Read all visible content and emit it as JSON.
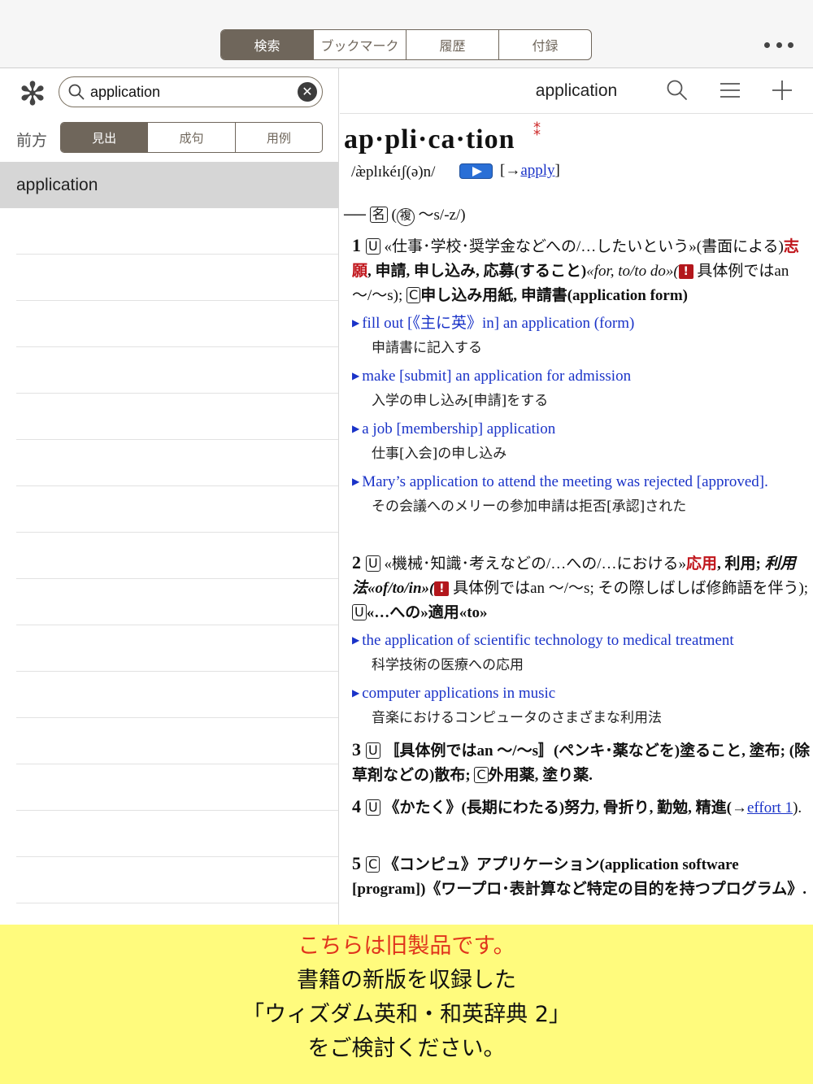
{
  "top_tabs": [
    "検索",
    "ブックマーク",
    "履歴",
    "付録"
  ],
  "top_tab_active": 0,
  "more_icon": "more-dots-icon",
  "search": {
    "value": "application",
    "clear_icon": "clear-icon",
    "search_icon": "search-icon",
    "wildcard_icon": "asterisk-icon"
  },
  "match_mode_label": "前方",
  "match_tabs": [
    "見出",
    "成句",
    "用例"
  ],
  "match_tab_active": 0,
  "results": [
    "application"
  ],
  "header": {
    "title": "application",
    "search_icon": "search-icon",
    "menu_icon": "menu-icon",
    "add_icon": "plus-icon"
  },
  "entry": {
    "headword": "ap·pli·ca·tion",
    "freq_mark": "⁑",
    "pronunciation": "/æ̀plɪkéɪʃ(ə)n/",
    "xref_prefix": "[→",
    "xref_link": "apply",
    "xref_suffix": "]",
    "pos_dash": "──",
    "pos": "名",
    "plural_mark": "複",
    "plural": "〜s/-z/)",
    "s1": {
      "num": "1",
      "label": "U",
      "t1": "«仕事･学校･奨学金などへの/…したいという»(書面による)",
      "red1": "志願",
      "t2": ", 申請, 申し込み, 応募(すること)",
      "t3": "«for, to/to do»(",
      "t4": "具体例ではan 〜/〜s);",
      "label2": "C",
      "t5": "申し込み用紙, 申請書(application form)"
    },
    "ex1": "fill out [《主に英》in] an application (form)",
    "ex1_tr": "申請書に記入する",
    "ex2": "make [submit] an application for admission",
    "ex2_tr": "入学の申し込み[申請]をする",
    "ex3": "a job [membership] application",
    "ex3_tr": "仕事[入会]の申し込み",
    "ex4": "Mary’s application to attend the meeting was rejected [approved].",
    "ex4_tr": "その会議へのメリーの参加申請は拒否[承認]された",
    "s2": {
      "num": "2",
      "label": "U",
      "t1": "«機械･知識･考えなどの/…への/…における»",
      "red1": "応用",
      "t2": ", 利用;",
      "t3": "利用法«of/to/in»(",
      "t4": "具体例ではan 〜/〜s; その際しばしば修飾語を伴う);",
      "label2": "U",
      "t5": "«…への»適用«to»"
    },
    "ex5": "the application of scientific technology to medical treatment",
    "ex5_tr": "科学技術の医療への応用",
    "ex6": "computer applications in music",
    "ex6_tr": "音楽におけるコンピュータのさまざまな利用法",
    "s3": {
      "num": "3",
      "label": "U",
      "t1": "〚具体例ではan 〜/〜s〛(ペンキ･薬などを)塗ること, 塗布; (除草剤などの)散布;",
      "label2": "C",
      "t2": "外用薬, 塗り薬."
    },
    "s4": {
      "num": "4",
      "label": "U",
      "t1": "《かたく》(長期にわたる)努力, 骨折り, 勤勉, 精進(→",
      "link": "effort 1",
      "t2": ")."
    },
    "s5": {
      "num": "5",
      "label": "C",
      "t1": "《コンピュ》アプリケーション(application software [program])《ワープロ･表計算など特定の目的を持つプログラム》."
    }
  },
  "banner": {
    "line1": "こちらは旧製品です。",
    "line2": "書籍の新版を収録した",
    "line3": "「ウィズダム英和・和英辞典 2」",
    "line4": "をご検討ください。"
  }
}
